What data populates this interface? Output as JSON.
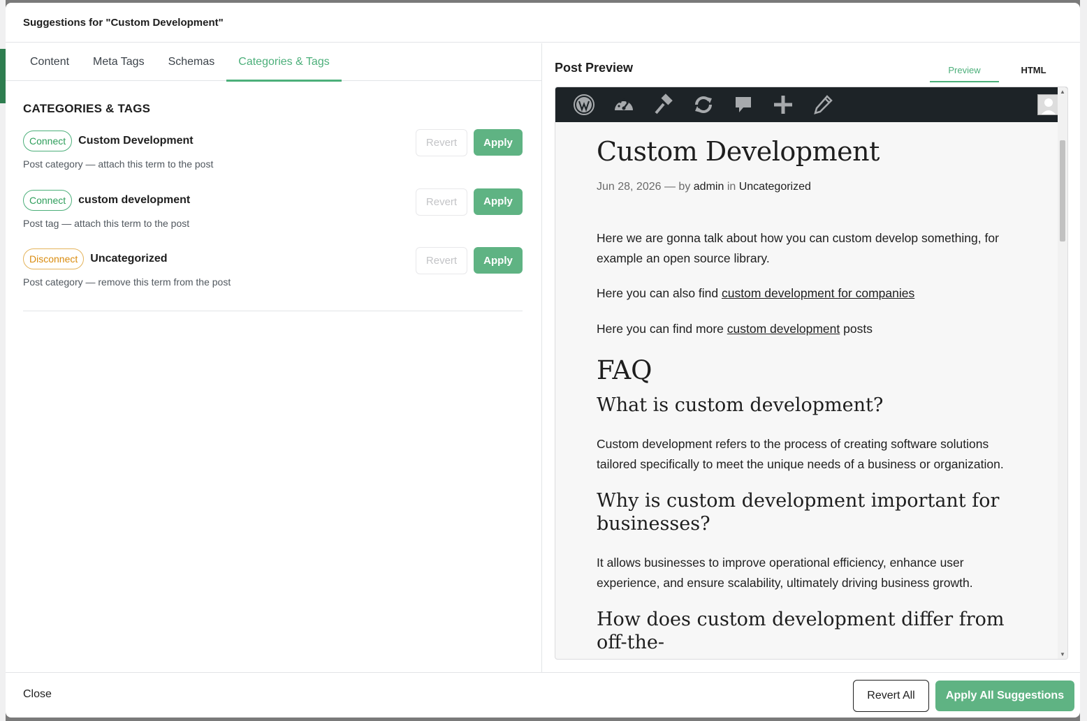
{
  "modal": {
    "title": "Suggestions for \"Custom Development\""
  },
  "tabs": [
    {
      "label": "Content"
    },
    {
      "label": "Meta Tags"
    },
    {
      "label": "Schemas"
    },
    {
      "label": "Categories & Tags",
      "active": true
    }
  ],
  "section": {
    "title": "CATEGORIES & TAGS",
    "items": [
      {
        "action": "Connect",
        "name": "Custom Development",
        "description": "Post category — attach this term to the post",
        "revert_label": "Revert",
        "apply_label": "Apply"
      },
      {
        "action": "Connect",
        "name": "custom development",
        "description": "Post tag — attach this term to the post",
        "revert_label": "Revert",
        "apply_label": "Apply"
      },
      {
        "action": "Disconnect",
        "name": "Uncategorized",
        "description": "Post category — remove this term from the post",
        "revert_label": "Revert",
        "apply_label": "Apply"
      }
    ]
  },
  "preview": {
    "title": "Post Preview",
    "tabs": [
      {
        "label": "Preview",
        "active": true
      },
      {
        "label": "HTML"
      }
    ],
    "toolbar_icons": [
      "wordpress-logo-icon",
      "dashboard-icon",
      "customize-icon",
      "updates-icon",
      "comments-icon",
      "new-content-icon",
      "edit-icon"
    ],
    "post": {
      "title": "Custom Development",
      "date": "Jun 28, 2026",
      "by_sep": "— by",
      "author": "admin",
      "in_sep": "in",
      "category": "Uncategorized",
      "p1": "Here we are gonna talk about how you can custom develop something, for example an open source library.",
      "p2_prefix": "Here you can also find ",
      "p2_link": "custom development for companies",
      "p3_prefix": "Here you can find more ",
      "p3_link": "custom development",
      "p3_suffix": " posts",
      "faq_heading": "FAQ",
      "q1": "What is custom development?",
      "a1": "Custom development refers to the process of creating software solutions tailored specifically to meet the unique needs of a business or organization.",
      "q2": "Why is custom development important for businesses?",
      "a2": "It allows businesses to improve operational efficiency, enhance user experience, and ensure scalability, ultimately driving business growth.",
      "q3": "How does custom development differ from off-the-"
    }
  },
  "footer": {
    "close_label": "Close",
    "revert_all_label": "Revert All",
    "apply_all_label": "Apply All Suggestions"
  },
  "colors": {
    "accent": "#5fb383",
    "accent_text": "#4caf7a",
    "disconnect": "#d98b0e",
    "admin_bar": "#1d2327"
  }
}
